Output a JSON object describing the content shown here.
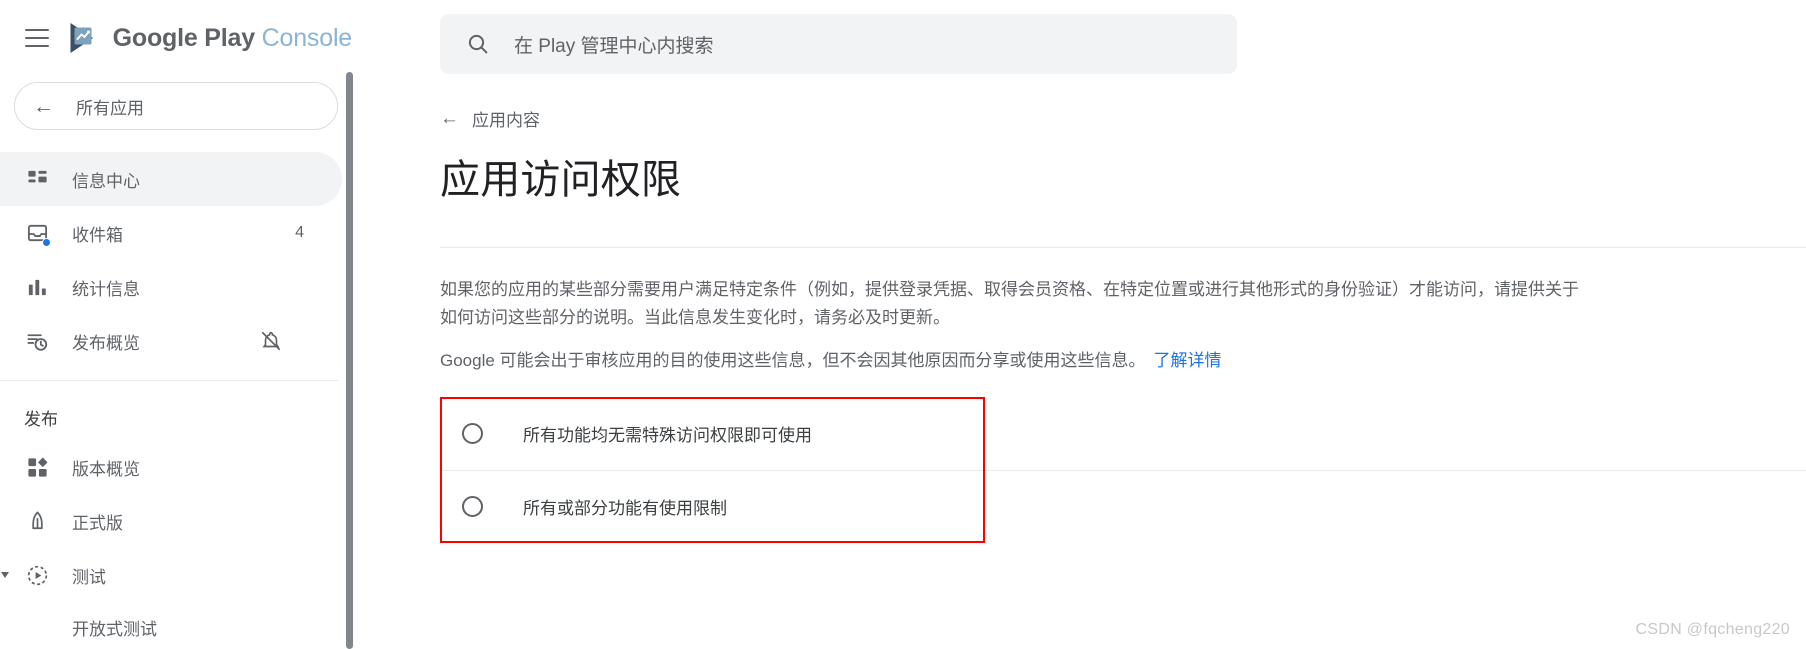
{
  "brand": {
    "name_strong": "Google Play",
    "name_light": "Console",
    "logo_icon": "play-console-logo-icon",
    "menu_icon": "hamburger-menu-icon"
  },
  "sidebar": {
    "all_apps": {
      "label": "所有应用",
      "icon": "back-arrow-icon"
    },
    "items": [
      {
        "label": "信息中心",
        "icon": "dashboard-icon",
        "active": true,
        "count": "",
        "trailing_icon": ""
      },
      {
        "label": "收件箱",
        "icon": "inbox-icon",
        "active": false,
        "count": "4",
        "trailing_icon": ""
      },
      {
        "label": "统计信息",
        "icon": "bar-chart-icon",
        "active": false,
        "count": "",
        "trailing_icon": ""
      },
      {
        "label": "发布概览",
        "icon": "release-clock-icon",
        "active": false,
        "count": "",
        "trailing_icon": "notifications-off-icon"
      }
    ],
    "section_title": "发布",
    "publish_items": [
      {
        "label": "版本概览",
        "icon": "release-grid-icon",
        "expandable": false
      },
      {
        "label": "正式版",
        "icon": "rocket-icon",
        "expandable": false
      },
      {
        "label": "测试",
        "icon": "testing-play-icon",
        "expandable": true
      }
    ],
    "sub_items": [
      {
        "label": "开放式测试"
      }
    ]
  },
  "search": {
    "placeholder": "在 Play 管理中心内搜索",
    "icon": "search-icon"
  },
  "page": {
    "breadcrumb": {
      "label": "应用内容",
      "icon": "back-arrow-icon"
    },
    "title": "应用访问权限",
    "paragraph_1": "如果您的应用的某些部分需要用户满足特定条件（例如，提供登录凭据、取得会员资格、在特定位置或进行其他形式的身份验证）才能访问，请提供关于如何访问这些部分的说明。当此信息发生变化时，请务必及时更新。",
    "paragraph_2": "Google 可能会出于审核应用的目的使用这些信息，但不会因其他原因而分享或使用这些信息。",
    "learn_more": "了解详情"
  },
  "radio_options": [
    {
      "label": "所有功能均无需特殊访问权限即可使用",
      "selected": false
    },
    {
      "label": "所有或部分功能有使用限制",
      "selected": false
    }
  ],
  "watermark": "CSDN @fqcheng220",
  "colors": {
    "accent_blue": "#1a73e8",
    "annotation_red": "#fe0000",
    "text_primary": "#202124",
    "text_secondary": "#5f6368",
    "active_bg": "#f1f3f4",
    "logo_dark": "#3c4f63",
    "logo_light": "#7da2bd"
  }
}
